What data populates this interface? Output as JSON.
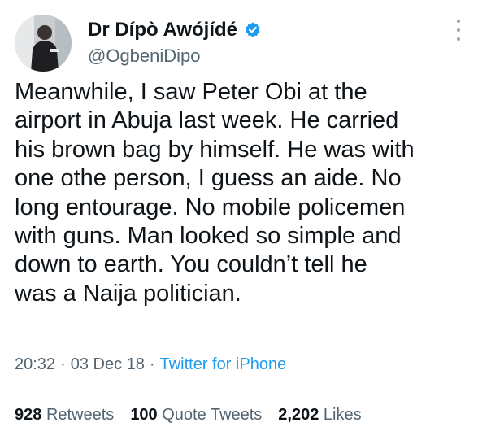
{
  "author": {
    "display_name": "Dr Dípò Awójídé",
    "handle": "@OgbeniDipo"
  },
  "tweet": {
    "lines": [
      "Meanwhile, I saw Peter Obi at the",
      "airport in Abuja last week. He carried",
      "his brown bag by himself. He was with",
      "one othe person, I guess an aide. No",
      "long entourage. No mobile policemen",
      "with guns. Man looked so simple and",
      "down to earth. You couldn’t tell he",
      "was a Naija politician."
    ]
  },
  "meta": {
    "time": "20:32",
    "date": "03 Dec 18",
    "source": "Twitter for iPhone",
    "separator": "·"
  },
  "stats": {
    "retweets": {
      "count": "928",
      "label": "Retweets"
    },
    "quotes": {
      "count": "100",
      "label": "Quote Tweets"
    },
    "likes": {
      "count": "2,202",
      "label": "Likes"
    }
  },
  "colors": {
    "verified_badge": "#1d9bf0",
    "link": "#1d9bf0",
    "secondary_text": "#536471"
  },
  "icons": {
    "verified": "verified-badge-icon",
    "more": "more-options-icon"
  }
}
